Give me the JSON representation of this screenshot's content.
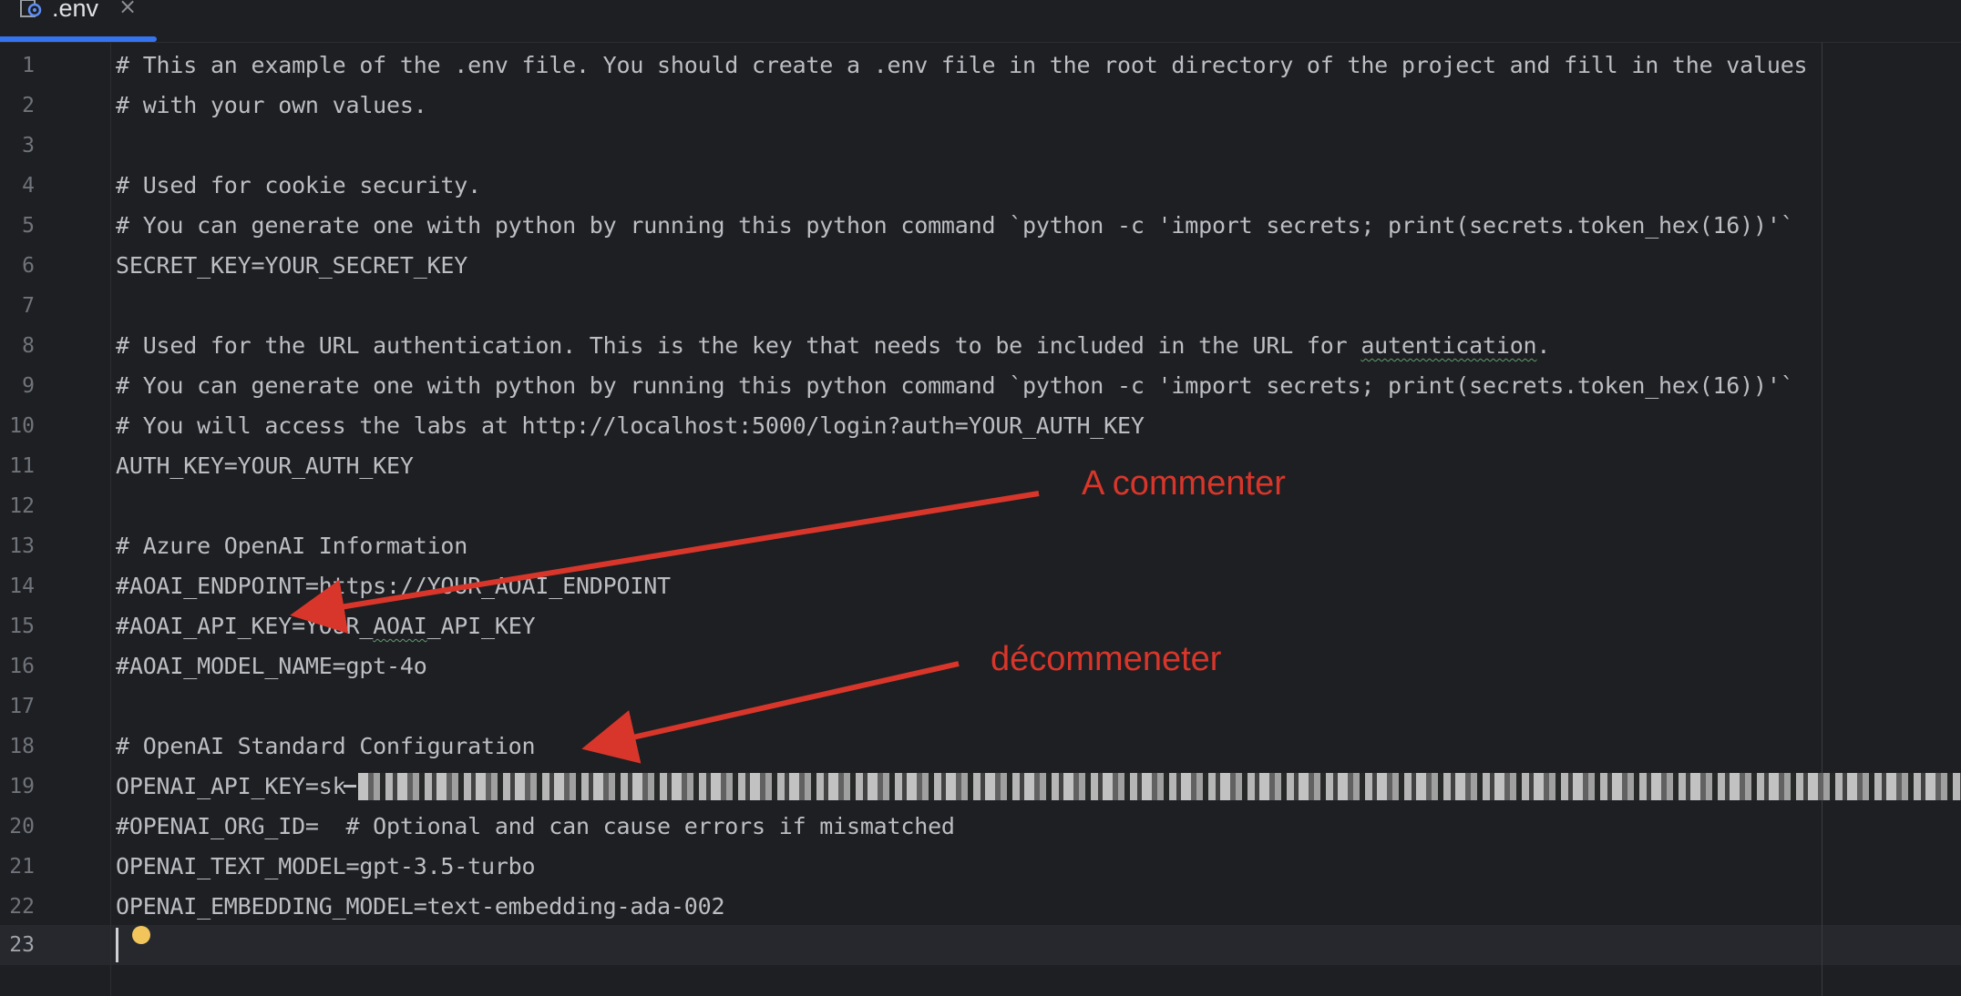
{
  "tab": {
    "title": ".env",
    "close_label": "×",
    "icon": "settings-file-icon"
  },
  "editor": {
    "lines": [
      {
        "number": "1",
        "text": "# This an example of the .env file. You should create a .env file in the root directory of the project and fill in the values"
      },
      {
        "number": "2",
        "text": "# with your own values."
      },
      {
        "number": "3",
        "text": ""
      },
      {
        "number": "4",
        "text": "# Used for cookie security."
      },
      {
        "number": "5",
        "text": "# You can generate one with python by running this python command `python -c 'import secrets; print(secrets.token_hex(16))'`"
      },
      {
        "number": "6",
        "text": "SECRET_KEY=YOUR_SECRET_KEY"
      },
      {
        "number": "7",
        "text": ""
      },
      {
        "number": "8",
        "text_before": "# Used for the URL authentication. This is the key that needs to be included in the URL for ",
        "text_squiggle": "autentication",
        "text_after": "."
      },
      {
        "number": "9",
        "text": "# You can generate one with python by running this python command `python -c 'import secrets; print(secrets.token_hex(16))'`"
      },
      {
        "number": "10",
        "text": "# You will access the labs at http://localhost:5000/login?auth=YOUR_AUTH_KEY"
      },
      {
        "number": "11",
        "text": "AUTH_KEY=YOUR_AUTH_KEY"
      },
      {
        "number": "12",
        "text": ""
      },
      {
        "number": "13",
        "text": "# Azure OpenAI Information"
      },
      {
        "number": "14",
        "text": "#AOAI_ENDPOINT=https://YOUR_AOAI_ENDPOINT"
      },
      {
        "number": "15",
        "text_before": "#AOAI_API_KEY=YOUR_",
        "text_squiggle": "AOAI",
        "text_after": "_API_KEY"
      },
      {
        "number": "16",
        "text": "#AOAI_MODEL_NAME=gpt-4o"
      },
      {
        "number": "17",
        "text": ""
      },
      {
        "number": "18",
        "text": "# OpenAI Standard Configuration"
      },
      {
        "number": "19",
        "text": "OPENAI_API_KEY=sk"
      },
      {
        "number": "20",
        "text": "#OPENAI_ORG_ID=  # Optional and can cause errors if mismatched"
      },
      {
        "number": "21",
        "text": "OPENAI_TEXT_MODEL=gpt-3.5-turbo"
      },
      {
        "number": "22",
        "text": "OPENAI_EMBEDDING_MODEL=text-embedding-ada-002"
      },
      {
        "number": "23",
        "text": ""
      }
    ],
    "current_line": "23"
  },
  "annotations": {
    "first": "A commenter",
    "second": "décommeneter"
  },
  "colors": {
    "background": "#1e1f22",
    "text": "#bcbec4",
    "line_number": "#6f737a",
    "annotation": "#d9362b",
    "tab_accent": "#3574f0"
  }
}
